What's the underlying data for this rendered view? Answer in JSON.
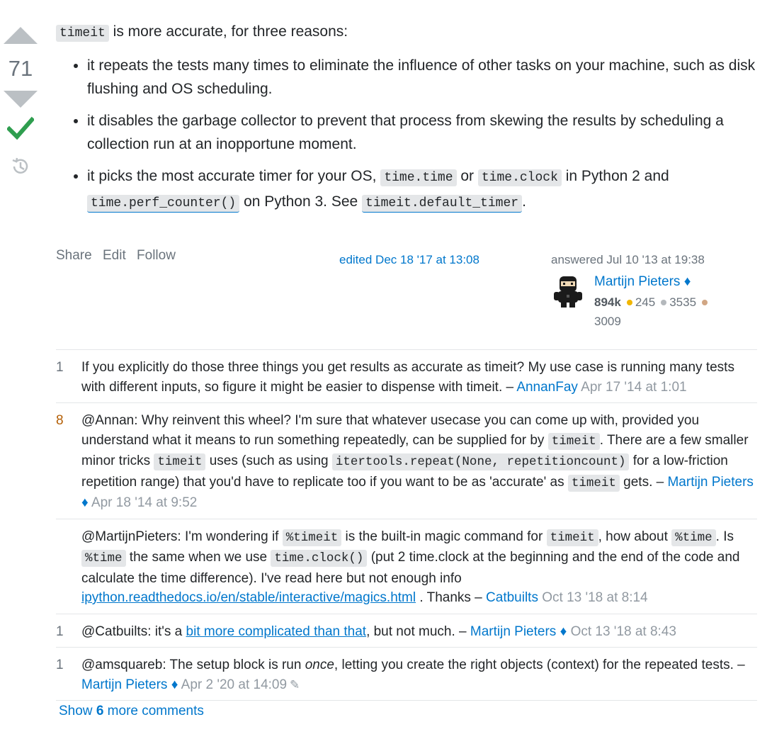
{
  "vote": {
    "score": "71"
  },
  "post": {
    "intro_code": "timeit",
    "intro_text": " is more accurate, for three reasons:",
    "bullet1": "it repeats the tests many times to eliminate the influence of other tasks on your machine, such as disk flushing and OS scheduling.",
    "bullet2": "it disables the garbage collector to prevent that process from skewing the results by scheduling a collection run at an inopportune moment.",
    "bullet3_a": "it picks the most accurate timer for your OS, ",
    "bullet3_code1": "time.time",
    "bullet3_b": " or ",
    "bullet3_code2": "time.clock",
    "bullet3_c": " in Python 2 and ",
    "bullet3_code3": "time.perf_counter()",
    "bullet3_d": " on Python 3. See ",
    "bullet3_code4": "timeit.default_timer",
    "bullet3_e": "."
  },
  "menu": {
    "share": "Share",
    "edit": "Edit",
    "follow": "Follow"
  },
  "edited": "edited Dec 18 '17 at 13:08",
  "answered": "answered Jul 10 '13 at 19:38",
  "user": {
    "name": "Martijn Pieters",
    "diamond": "♦",
    "rep": "894k",
    "gold": "245",
    "silver": "3535",
    "bronze": "3009"
  },
  "colors": {
    "gold": "#f1b600",
    "silver": "#b4b8bc",
    "bronze": "#d1a684",
    "link": "#0077cc",
    "accepted": "#2f9e4f"
  },
  "icons": {
    "accepted": "check-icon",
    "history": "history-icon",
    "edit": "pencil-icon"
  },
  "comments": [
    {
      "score": "1",
      "text": "If you explicitly do those three things you get results as accurate as timeit? My use case is running many tests with different inputs, so figure it might be easier to dispense with timeit. –",
      "user": "AnnanFay",
      "date": "Apr 17 '14 at 1:01"
    },
    {
      "score": "8",
      "t1": "@Annan: Why reinvent this wheel? I'm sure that whatever usecase you can come up with, provided you understand what it means to run something repeatedly, can be supplied for by ",
      "c1": "timeit",
      "t2": ". There are a few smaller minor tricks ",
      "c2": "timeit",
      "t3": " uses (such as using ",
      "c3": "itertools.repeat(None, repetitioncount)",
      "t4": " for a low-friction repetition range) that you'd have to replicate too if you want to be as 'accurate' as ",
      "c4": "timeit",
      "t5": " gets. –",
      "user": "Martijn Pieters",
      "diamond": "♦",
      "date": "Apr 18 '14 at 9:52"
    },
    {
      "score": "",
      "t1": "@MartijnPieters: I'm wondering if ",
      "c1": "%timeit",
      "t2": " is the built-in magic command for ",
      "c2": "timeit",
      "t3": ", how about ",
      "c3": "%time",
      "t4": ". Is ",
      "c4": "%time",
      "t5": " the same when we use ",
      "c5": "time.clock()",
      "t6": " (put 2 time.clock at the beginning and the end of the code and calculate the time difference). I've read here but not enough info ",
      "link": "ipython.readthedocs.io/en/stable/interactive/magics.html",
      "t7": " . Thanks –",
      "user": "Catbuilts",
      "date": "Oct 13 '18 at 8:14"
    },
    {
      "score": "1",
      "t1": "@Catbuilts: it's a ",
      "link": "bit more complicated than that",
      "t2": ", but not much. –",
      "user": "Martijn Pieters",
      "diamond": "♦",
      "date": "Oct 13 '18 at 8:43"
    },
    {
      "score": "1",
      "t1": "@amsquareb: The setup block is run ",
      "em": "once",
      "t2": ", letting you create the right objects (context) for the repeated tests. –",
      "user": "Martijn Pieters",
      "diamond": "♦",
      "date": "Apr 2 '20 at 14:09"
    }
  ],
  "show_more": {
    "pre": "Show ",
    "count": "6",
    "post": " more comments"
  }
}
